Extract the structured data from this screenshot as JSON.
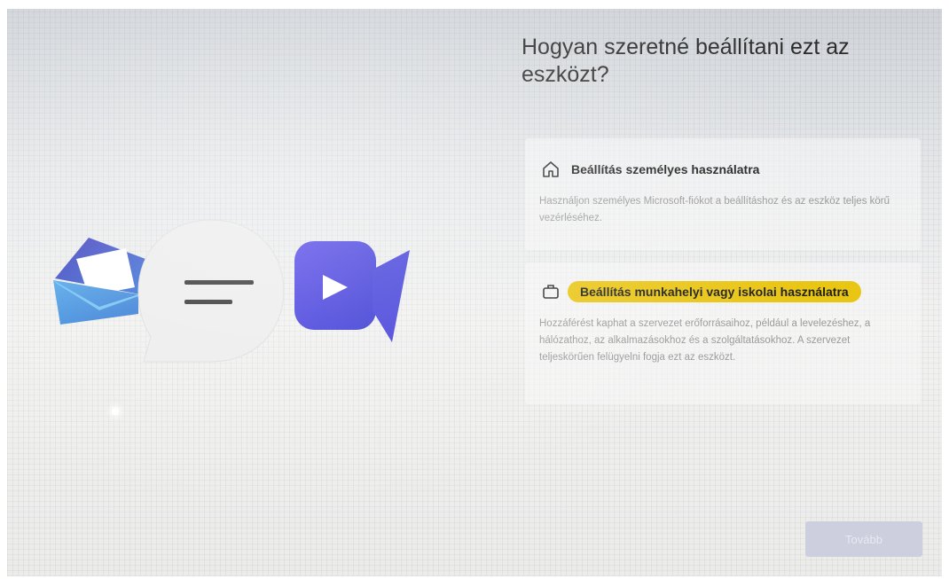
{
  "setup": {
    "title": "Hogyan szeretné beállítani ezt az eszközt?",
    "options": [
      {
        "icon": "home-icon",
        "title": "Beállítás személyes használatra",
        "description": "Használjon személyes Microsoft-fiókot a beállításhoz és az eszköz teljes körű vezérléséhez."
      },
      {
        "icon": "briefcase-icon",
        "title": "Beállítás munkahelyi vagy iskolai használatra",
        "description": "Hozzáférést kaphat a szervezet erőforrásaihoz, például a levelezéshez, a hálózathoz, az alkalmazásokhoz és a szolgáltatásokhoz. A szervezet teljeskörűen felügyelni fogja ezt az eszközt."
      }
    ],
    "next_label": "Tovább"
  },
  "colors": {
    "highlight": "#e9c514",
    "accent_blue": "#3b3fe0",
    "button_disabled": "#cdcfdf"
  },
  "illustration": {
    "icons": [
      "mail-icon",
      "chat-bubble-icon",
      "video-call-icon"
    ]
  }
}
